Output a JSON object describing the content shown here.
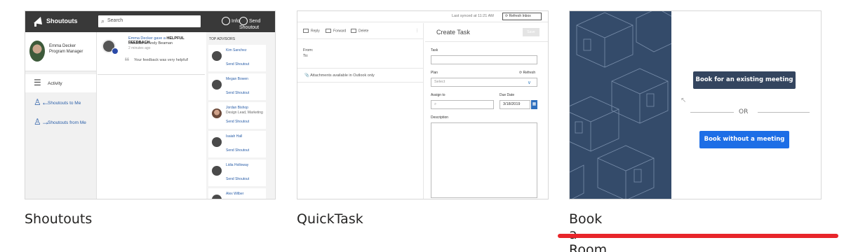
{
  "colors": {
    "accent": "#e8252a",
    "brand_blue": "#2e6fbd",
    "room_panel": "#344b6a",
    "room_btn_dark": "#34455f",
    "room_btn_blue": "#1d6ee6"
  },
  "cards": [
    {
      "title": "Shoutouts",
      "app": {
        "header_title": "Shoutouts",
        "search_placeholder": "Search",
        "info_label": "Info",
        "send_label": "Send Shoutout",
        "user_name": "Emma Decker",
        "user_role": "Program Manager",
        "nav": [
          "Activity",
          "Shoutouts to Me",
          "Shoutouts from Me"
        ],
        "post": {
          "line1_prefix": "Emma Decker gave a",
          "line1_badge": "HELPFUL FEEDBACK",
          "line2": "shoutout to Andy Beaman",
          "line3": "2 minutes ago",
          "quote": "Your feedback was very helpful!"
        },
        "right_header": "TOP ADVISORS",
        "advisors": [
          {
            "name": "Kim Sanchez",
            "sub": "",
            "action": "Send Shoutout",
            "photo": false
          },
          {
            "name": "Megan Bowen",
            "sub": "",
            "action": "Send Shoutout",
            "photo": false
          },
          {
            "name": "Jordan Bishop",
            "sub": "Design Lead, Marketing",
            "action": "Send Shoutout",
            "photo": true
          },
          {
            "name": "Isaiah Hall",
            "sub": "",
            "action": "Send Shoutout",
            "photo": false
          },
          {
            "name": "Lidia Holloway",
            "sub": "",
            "action": "Send Shoutout",
            "photo": false
          },
          {
            "name": "Alex Wilber",
            "sub": "",
            "action": "",
            "photo": false
          }
        ]
      }
    },
    {
      "title": "QuickTask",
      "app": {
        "last_synced": "Last synced at 11:21 AM",
        "refresh_label": "Refresh Inbox",
        "toolbar": [
          "Reply",
          "Forward",
          "Delete"
        ],
        "from_label": "From:",
        "to_label": "To:",
        "attachments_note": "Attachments available in Outlook only",
        "form_title": "Create Task",
        "save_label": "Save",
        "task_label": "Task",
        "plan_label": "Plan",
        "plan_refresh": "Refresh",
        "plan_placeholder": "Select",
        "assign_label": "Assign to",
        "due_label": "Due Date",
        "due_value": "3/18/2019",
        "description_label": "Description"
      }
    },
    {
      "title": "Book a Room",
      "app": {
        "existing_meeting": "Book for an existing meeting",
        "or_label": "OR",
        "without_meeting": "Book without a meeting"
      }
    }
  ]
}
